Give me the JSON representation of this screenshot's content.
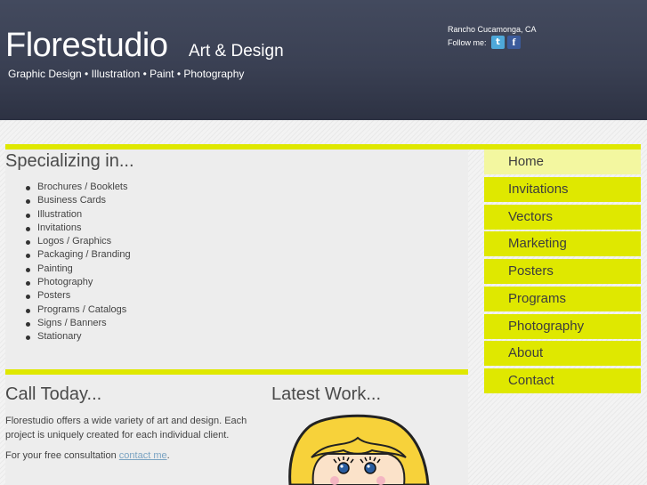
{
  "header": {
    "logo_main": "Florestudio",
    "logo_sub": "Art & Design",
    "tagline": "Graphic Design • Illustration • Paint • Photography",
    "location": "Rancho Cucamonga, CA",
    "follow_label": "Follow me:",
    "social": [
      {
        "name": "twitter-icon",
        "glyph": "t"
      },
      {
        "name": "facebook-icon",
        "glyph": "f"
      }
    ]
  },
  "specializing": {
    "title": "Specializing in...",
    "items": [
      "Brochures / Booklets",
      "Business Cards",
      "Illustration",
      "Invitations",
      "Logos / Graphics",
      "Packaging / Branding",
      "Painting",
      "Photography",
      "Posters",
      "Programs / Catalogs",
      "Signs / Banners",
      "Stationary"
    ]
  },
  "call": {
    "title": "Call Today...",
    "text": "Florestudio offers a wide variety of art and design. Each project is uniquely created for each individual client.",
    "consult_prefix": "For your free consultation ",
    "consult_link": "contact me",
    "consult_suffix": "."
  },
  "latest": {
    "title": "Latest Work..."
  },
  "nav": {
    "active_index": 0,
    "items": [
      "Home",
      "Invitations",
      "Vectors",
      "Marketing",
      "Posters",
      "Programs",
      "Photography",
      "About",
      "Contact"
    ]
  },
  "colors": {
    "accent": "#dfe800",
    "nav_active": "#f3f7a0",
    "header": "#3a4053",
    "link": "#7aa3c2"
  }
}
